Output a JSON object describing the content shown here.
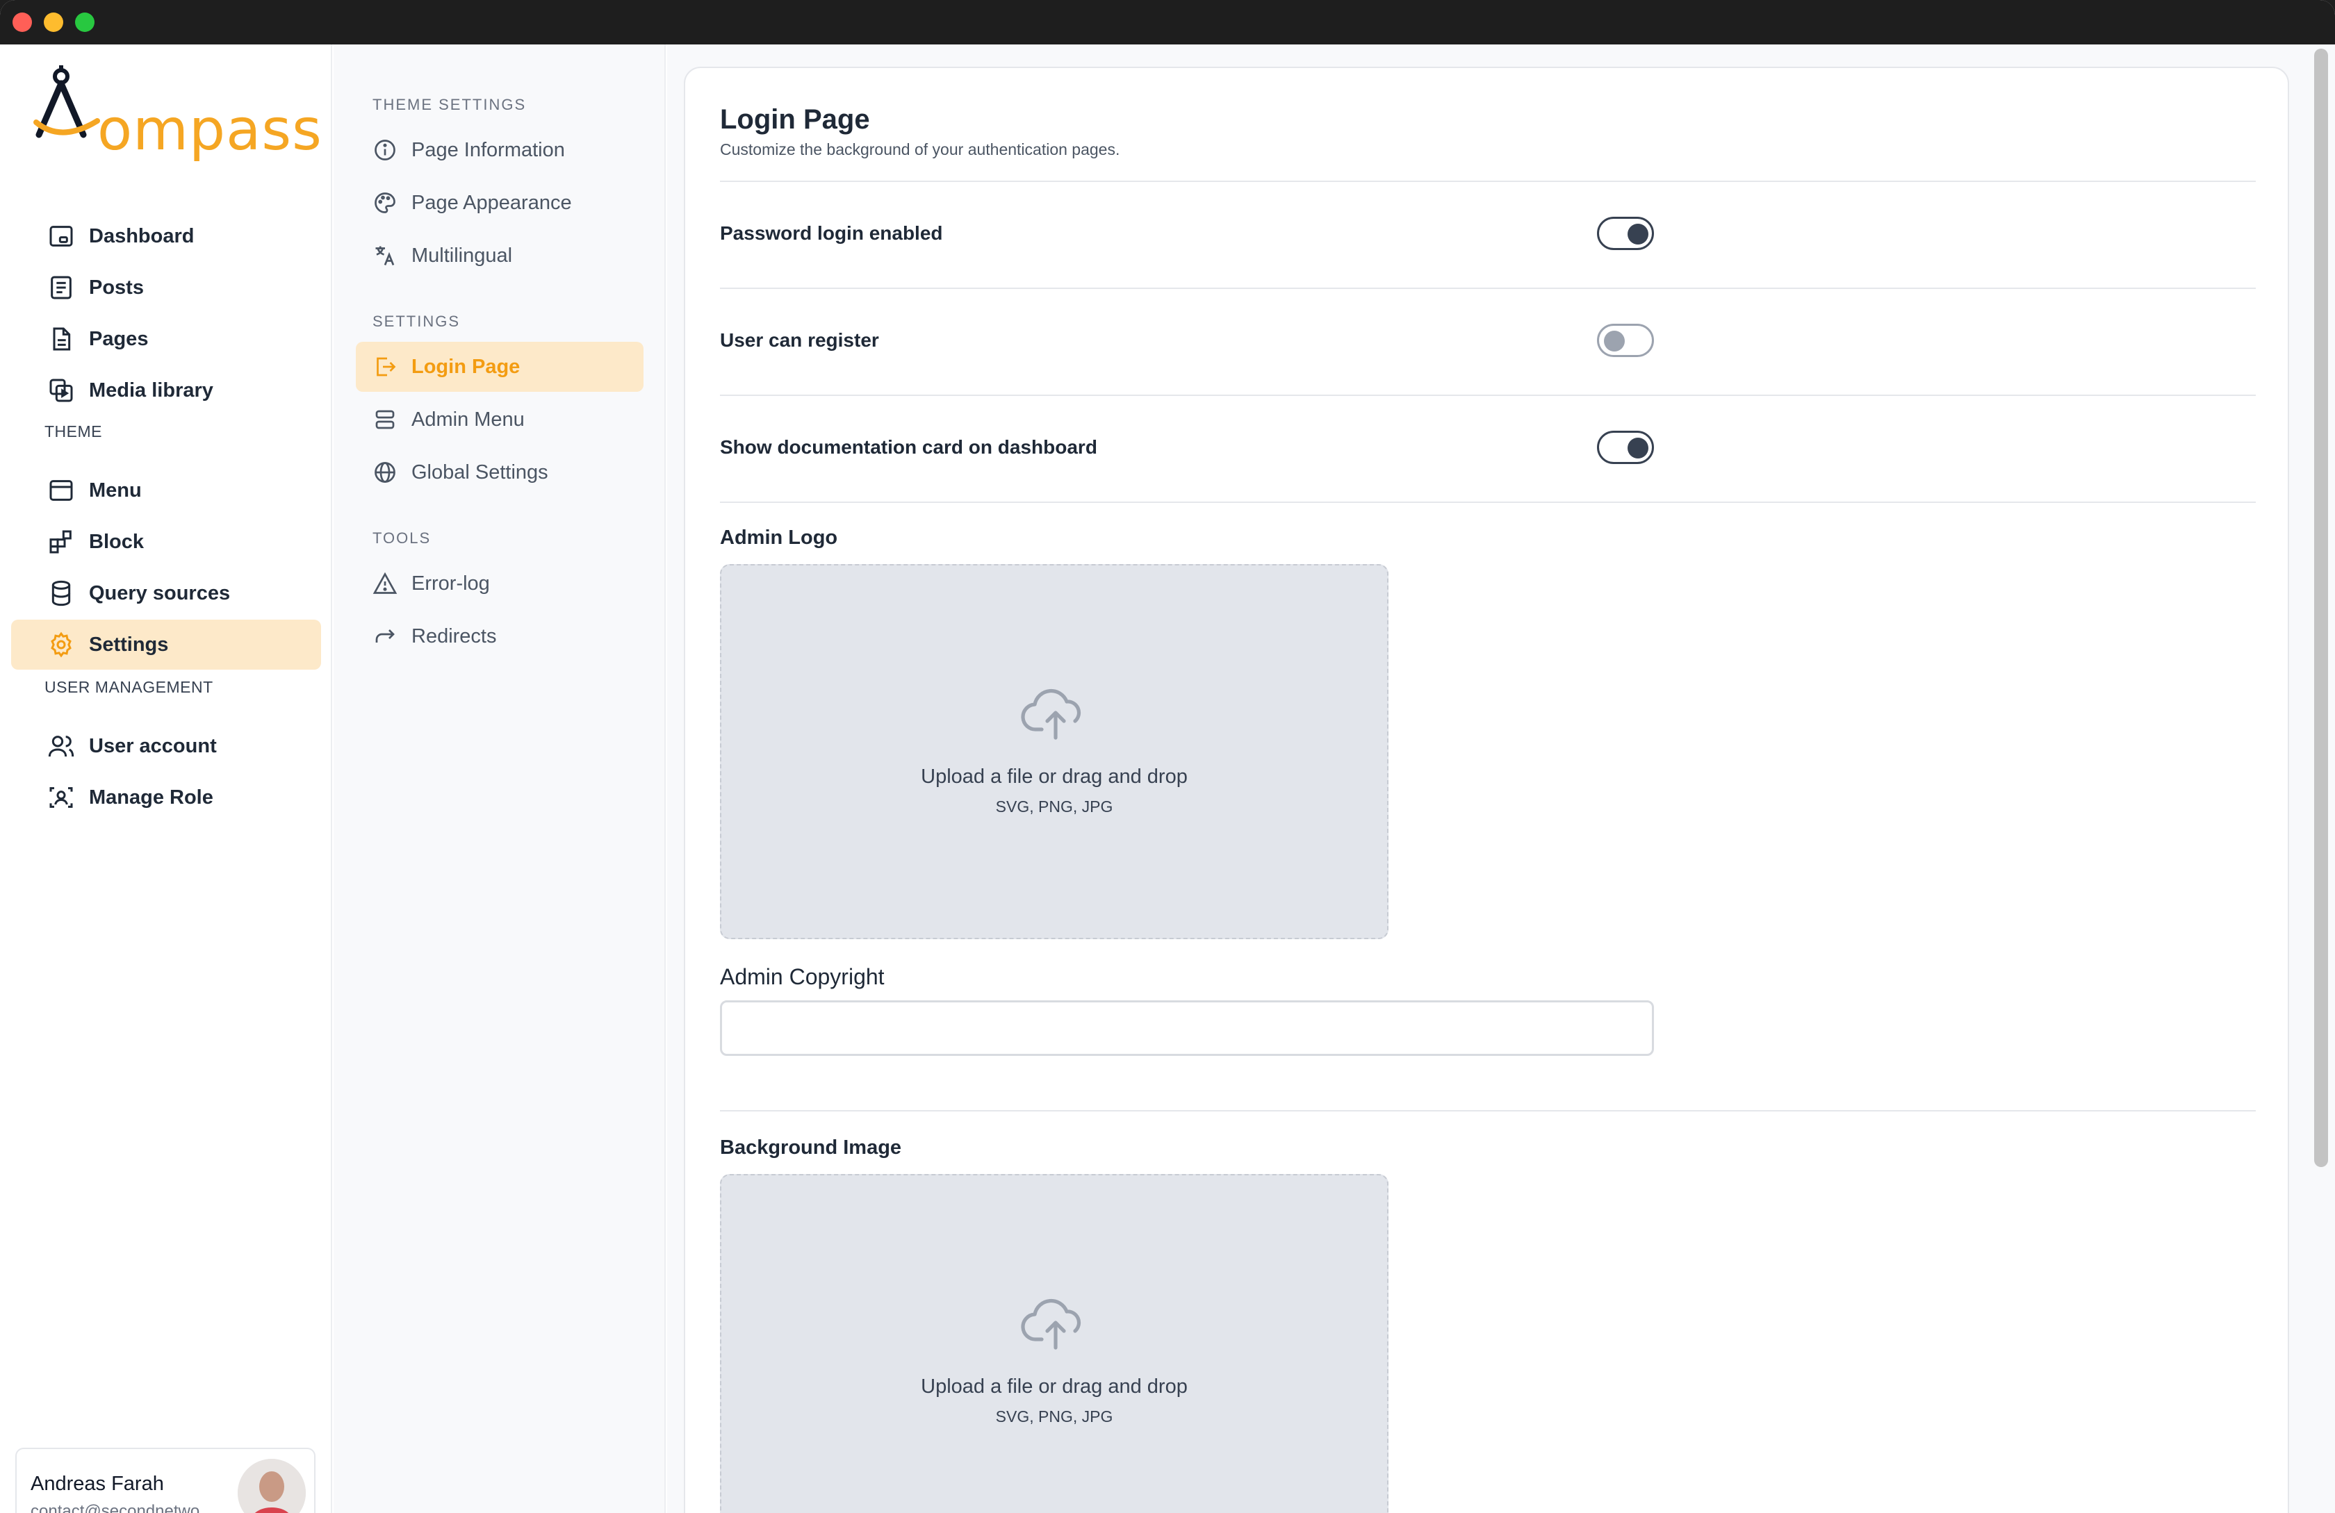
{
  "app": {
    "brand": "ompass"
  },
  "sidebar": {
    "items": [
      {
        "label": "Dashboard",
        "icon": "dashboard-icon"
      },
      {
        "label": "Posts",
        "icon": "posts-icon"
      },
      {
        "label": "Pages",
        "icon": "pages-icon"
      },
      {
        "label": "Media library",
        "icon": "media-icon"
      }
    ],
    "theme_heading": "THEME",
    "theme_items": [
      {
        "label": "Menu",
        "icon": "menu-icon"
      },
      {
        "label": "Block",
        "icon": "block-icon"
      },
      {
        "label": "Query sources",
        "icon": "database-icon"
      },
      {
        "label": "Settings",
        "icon": "gear-icon",
        "active": true
      }
    ],
    "user_heading": "USER MANAGEMENT",
    "user_items": [
      {
        "label": "User account",
        "icon": "users-icon"
      },
      {
        "label": "Manage Role",
        "icon": "role-icon"
      }
    ],
    "accent_color": "#f39c12",
    "active_bg": "#fde9c9"
  },
  "user": {
    "name": "Andreas Farah",
    "email": "contact@secondnetwo..."
  },
  "subnav": {
    "theme_settings_heading": "THEME SETTINGS",
    "theme_settings": [
      {
        "label": "Page Information",
        "icon": "info-icon"
      },
      {
        "label": "Page Appearance",
        "icon": "palette-icon"
      },
      {
        "label": "Multilingual",
        "icon": "translate-icon"
      }
    ],
    "settings_heading": "SETTINGS",
    "settings": [
      {
        "label": "Login Page",
        "icon": "login-icon",
        "active": true
      },
      {
        "label": "Admin Menu",
        "icon": "admin-menu-icon"
      },
      {
        "label": "Global Settings",
        "icon": "globe-icon"
      }
    ],
    "tools_heading": "TOOLS",
    "tools": [
      {
        "label": "Error-log",
        "icon": "warning-icon"
      },
      {
        "label": "Redirects",
        "icon": "redirect-icon"
      }
    ]
  },
  "main": {
    "title": "Login Page",
    "subtitle": "Customize the background of your authentication pages.",
    "toggles": [
      {
        "label": "Password login enabled",
        "on": true
      },
      {
        "label": "User can register",
        "on": false
      },
      {
        "label": "Show documentation card on dashboard",
        "on": true
      }
    ],
    "admin_logo_label": "Admin Logo",
    "upload_text": "Upload a file or drag and drop",
    "upload_hint": "SVG, PNG, JPG",
    "admin_copyright_label": "Admin Copyright",
    "admin_copyright_value": "",
    "background_image_label": "Background Image"
  }
}
